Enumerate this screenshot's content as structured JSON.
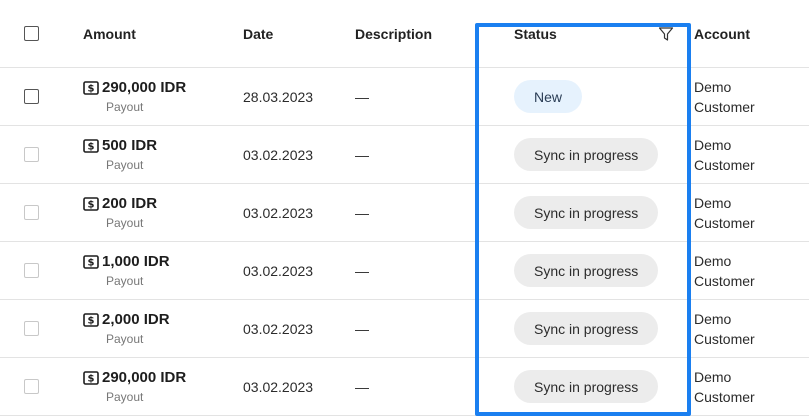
{
  "header": {
    "amount": "Amount",
    "date": "Date",
    "description": "Description",
    "status": "Status",
    "account": "Account"
  },
  "rows": [
    {
      "amount": "290,000 IDR",
      "type": "Payout",
      "date": "28.03.2023",
      "description": "—",
      "status": "New",
      "account": "Demo Customer"
    },
    {
      "amount": "500 IDR",
      "type": "Payout",
      "date": "03.02.2023",
      "description": "—",
      "status": "Sync in progress",
      "account": "Demo Customer"
    },
    {
      "amount": "200 IDR",
      "type": "Payout",
      "date": "03.02.2023",
      "description": "—",
      "status": "Sync in progress",
      "account": "Demo Customer"
    },
    {
      "amount": "1,000 IDR",
      "type": "Payout",
      "date": "03.02.2023",
      "description": "—",
      "status": "Sync in progress",
      "account": "Demo Customer"
    },
    {
      "amount": "2,000 IDR",
      "type": "Payout",
      "date": "03.02.2023",
      "description": "—",
      "status": "Sync in progress",
      "account": "Demo Customer"
    },
    {
      "amount": "290,000 IDR",
      "type": "Payout",
      "date": "03.02.2023",
      "description": "—",
      "status": "Sync in progress",
      "account": "Demo Customer"
    }
  ],
  "colors": {
    "highlight": "#1a7ff0",
    "pill_new_bg": "#e6f2fd",
    "pill_sync_bg": "#ececec"
  },
  "icons": {
    "amount": "money-icon",
    "status_filter": "filter-icon"
  }
}
